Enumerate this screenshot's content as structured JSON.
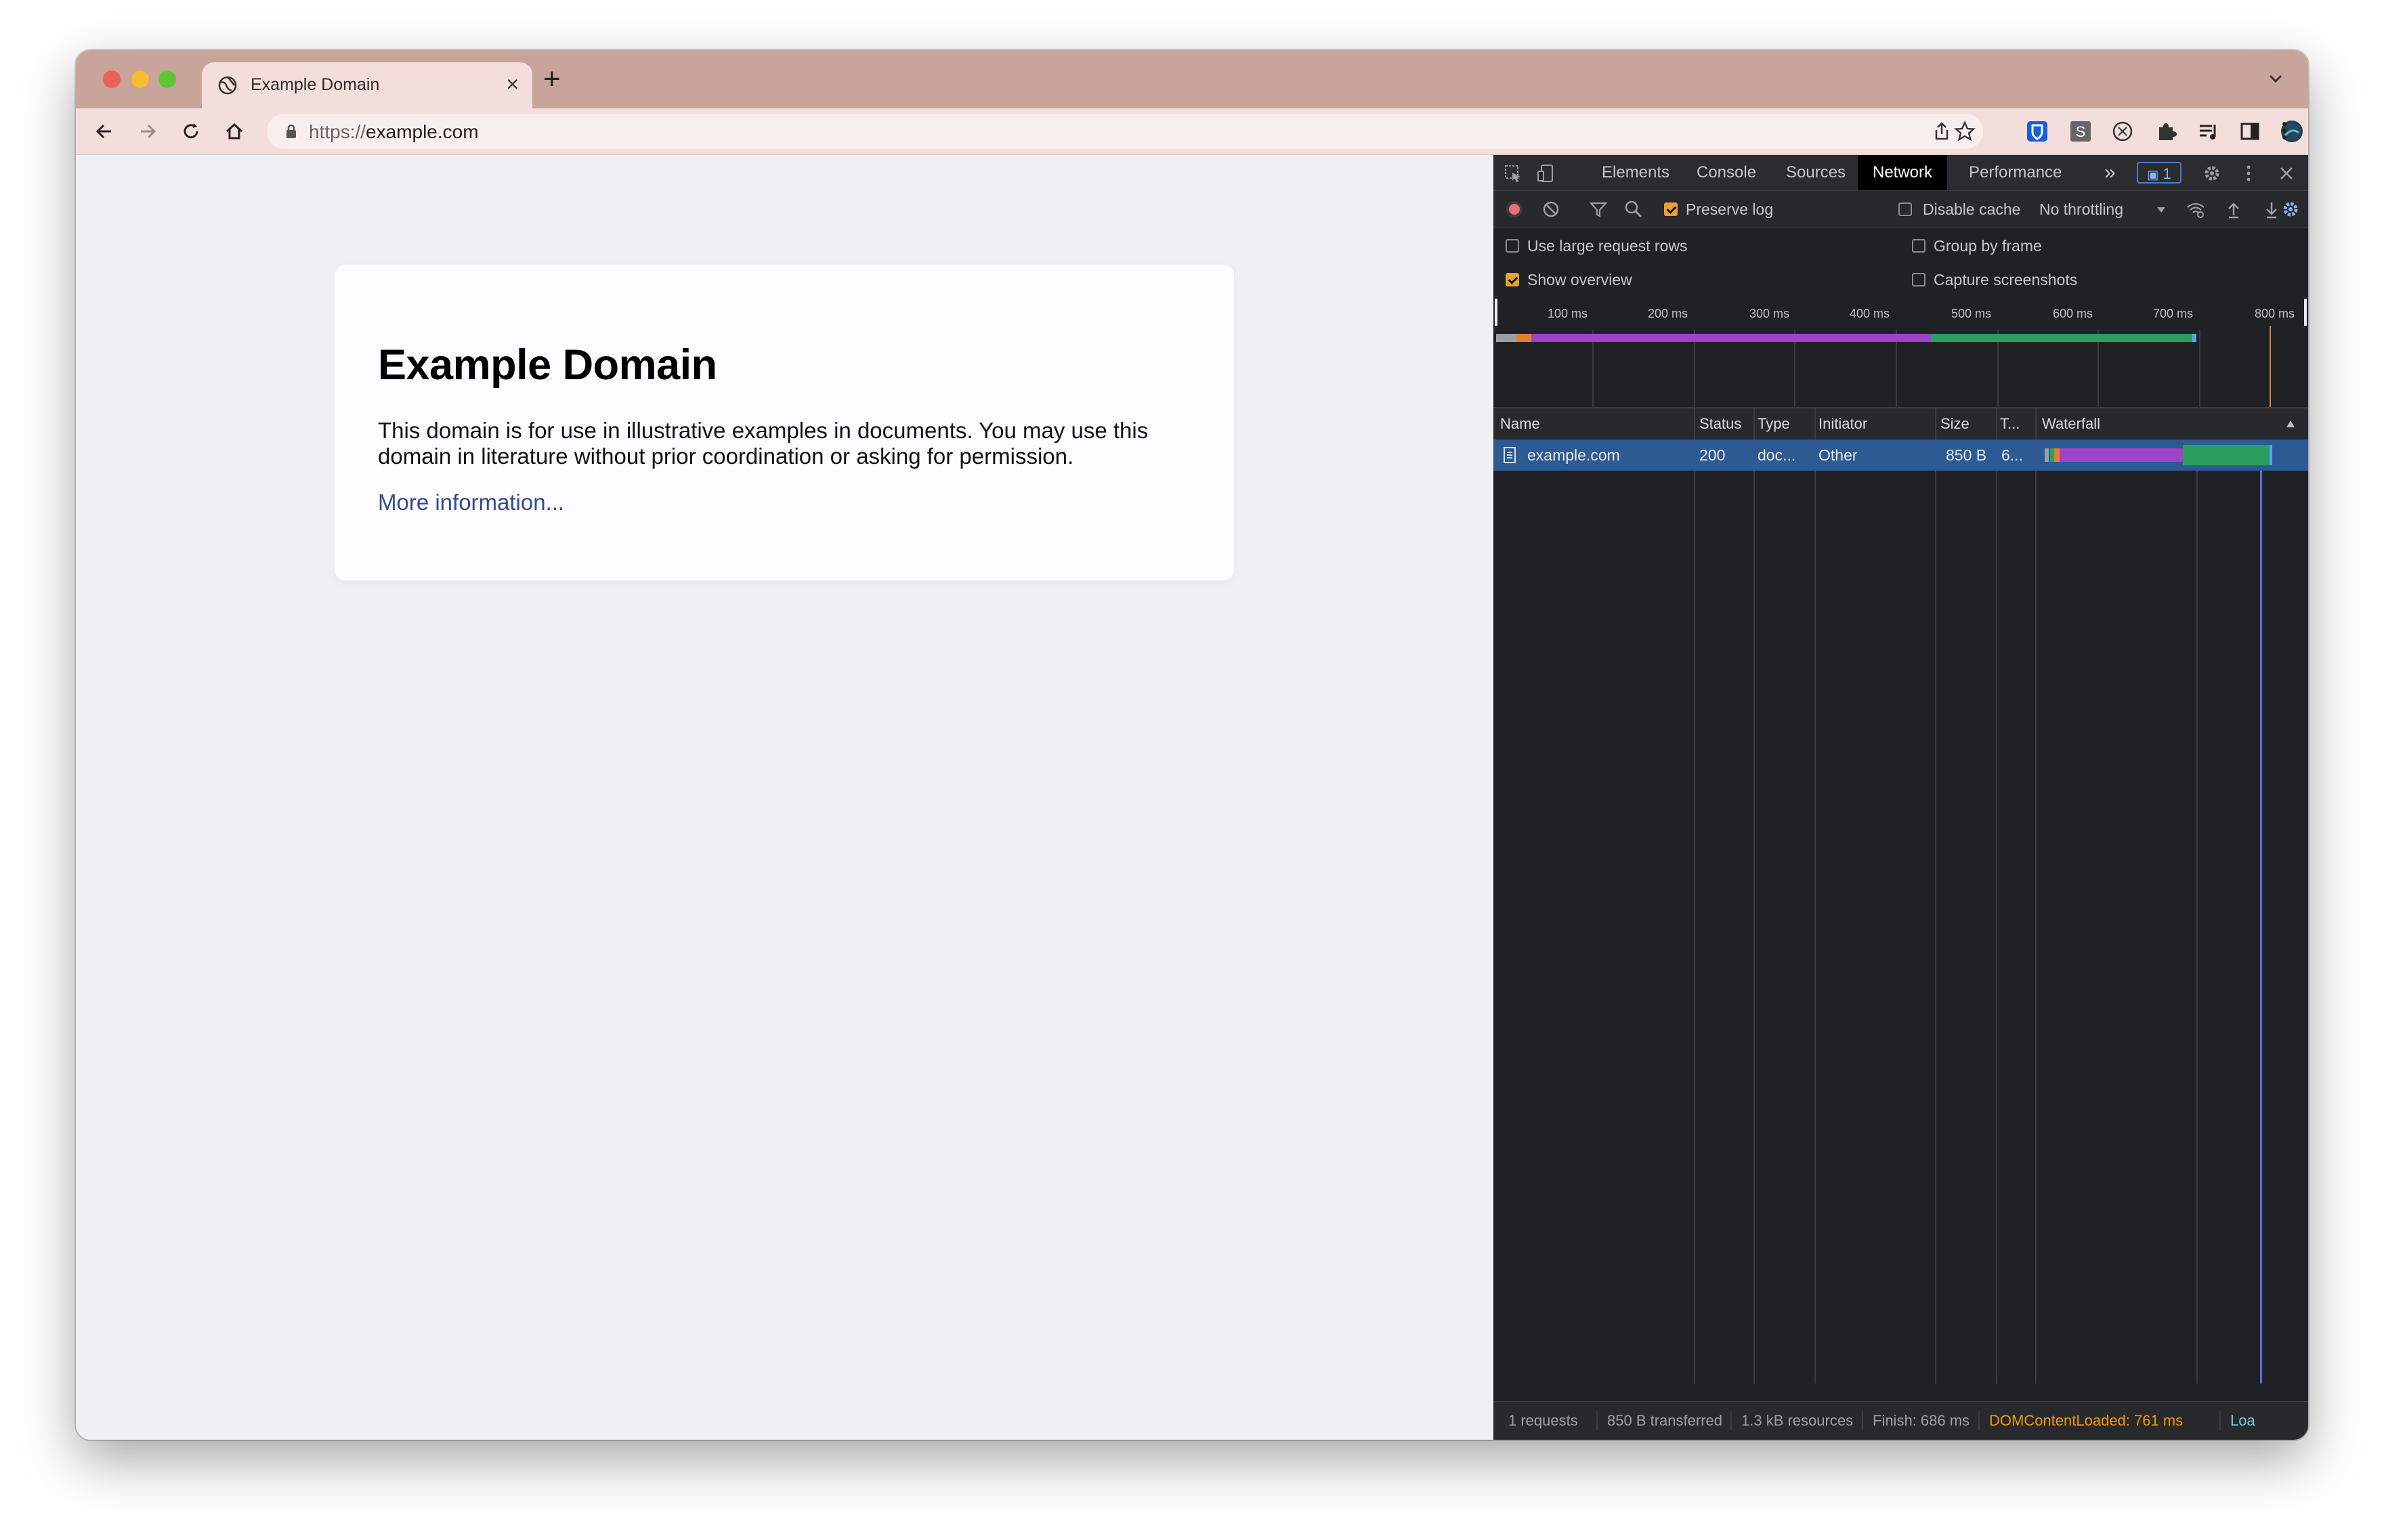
{
  "browser": {
    "tab": {
      "title": "Example Domain",
      "close": "×"
    },
    "new_tab": "+",
    "address": {
      "scheme": "https://",
      "host": "example.com"
    }
  },
  "page": {
    "heading": "Example Domain",
    "paragraph": "This domain is for use in illustrative examples in documents. You may use this domain in literature without prior coordination or asking for permission.",
    "link": "More information..."
  },
  "devtools": {
    "tabs": [
      "Elements",
      "Console",
      "Sources",
      "Network",
      "Performance"
    ],
    "active_tab": "Network",
    "more_tabs": "»",
    "issues_badge": "1",
    "toolbar": {
      "preserve_log": {
        "label": "Preserve log",
        "checked": true
      },
      "disable_cache": {
        "label": "Disable cache",
        "checked": false
      },
      "throttling": "No throttling"
    },
    "settings": {
      "large_rows": {
        "label": "Use large request rows",
        "checked": false
      },
      "group_by_frame": {
        "label": "Group by frame",
        "checked": false
      },
      "show_overview": {
        "label": "Show overview",
        "checked": true
      },
      "capture_screenshots": {
        "label": "Capture screenshots",
        "checked": false
      }
    },
    "overview_ticks": [
      "100 ms",
      "200 ms",
      "300 ms",
      "400 ms",
      "500 ms",
      "600 ms",
      "700 ms",
      "800 ms"
    ],
    "columns": [
      "Name",
      "Status",
      "Type",
      "Initiator",
      "Size",
      "T...",
      "Waterfall"
    ],
    "requests": [
      {
        "name": "example.com",
        "status": "200",
        "type": "doc...",
        "initiator": "Other",
        "size": "850 B",
        "time": "6..."
      }
    ],
    "footer": {
      "requests": "1 requests",
      "transferred": "850 B transferred",
      "resources": "1.3 kB resources",
      "finish": "Finish: 686 ms",
      "dom_content_loaded": "DOMContentLoaded: 761 ms",
      "load": "Loa"
    },
    "colors": {
      "dcl": "#f29900",
      "load": "#8ab4f8",
      "selection": "#2d5a92"
    }
  }
}
